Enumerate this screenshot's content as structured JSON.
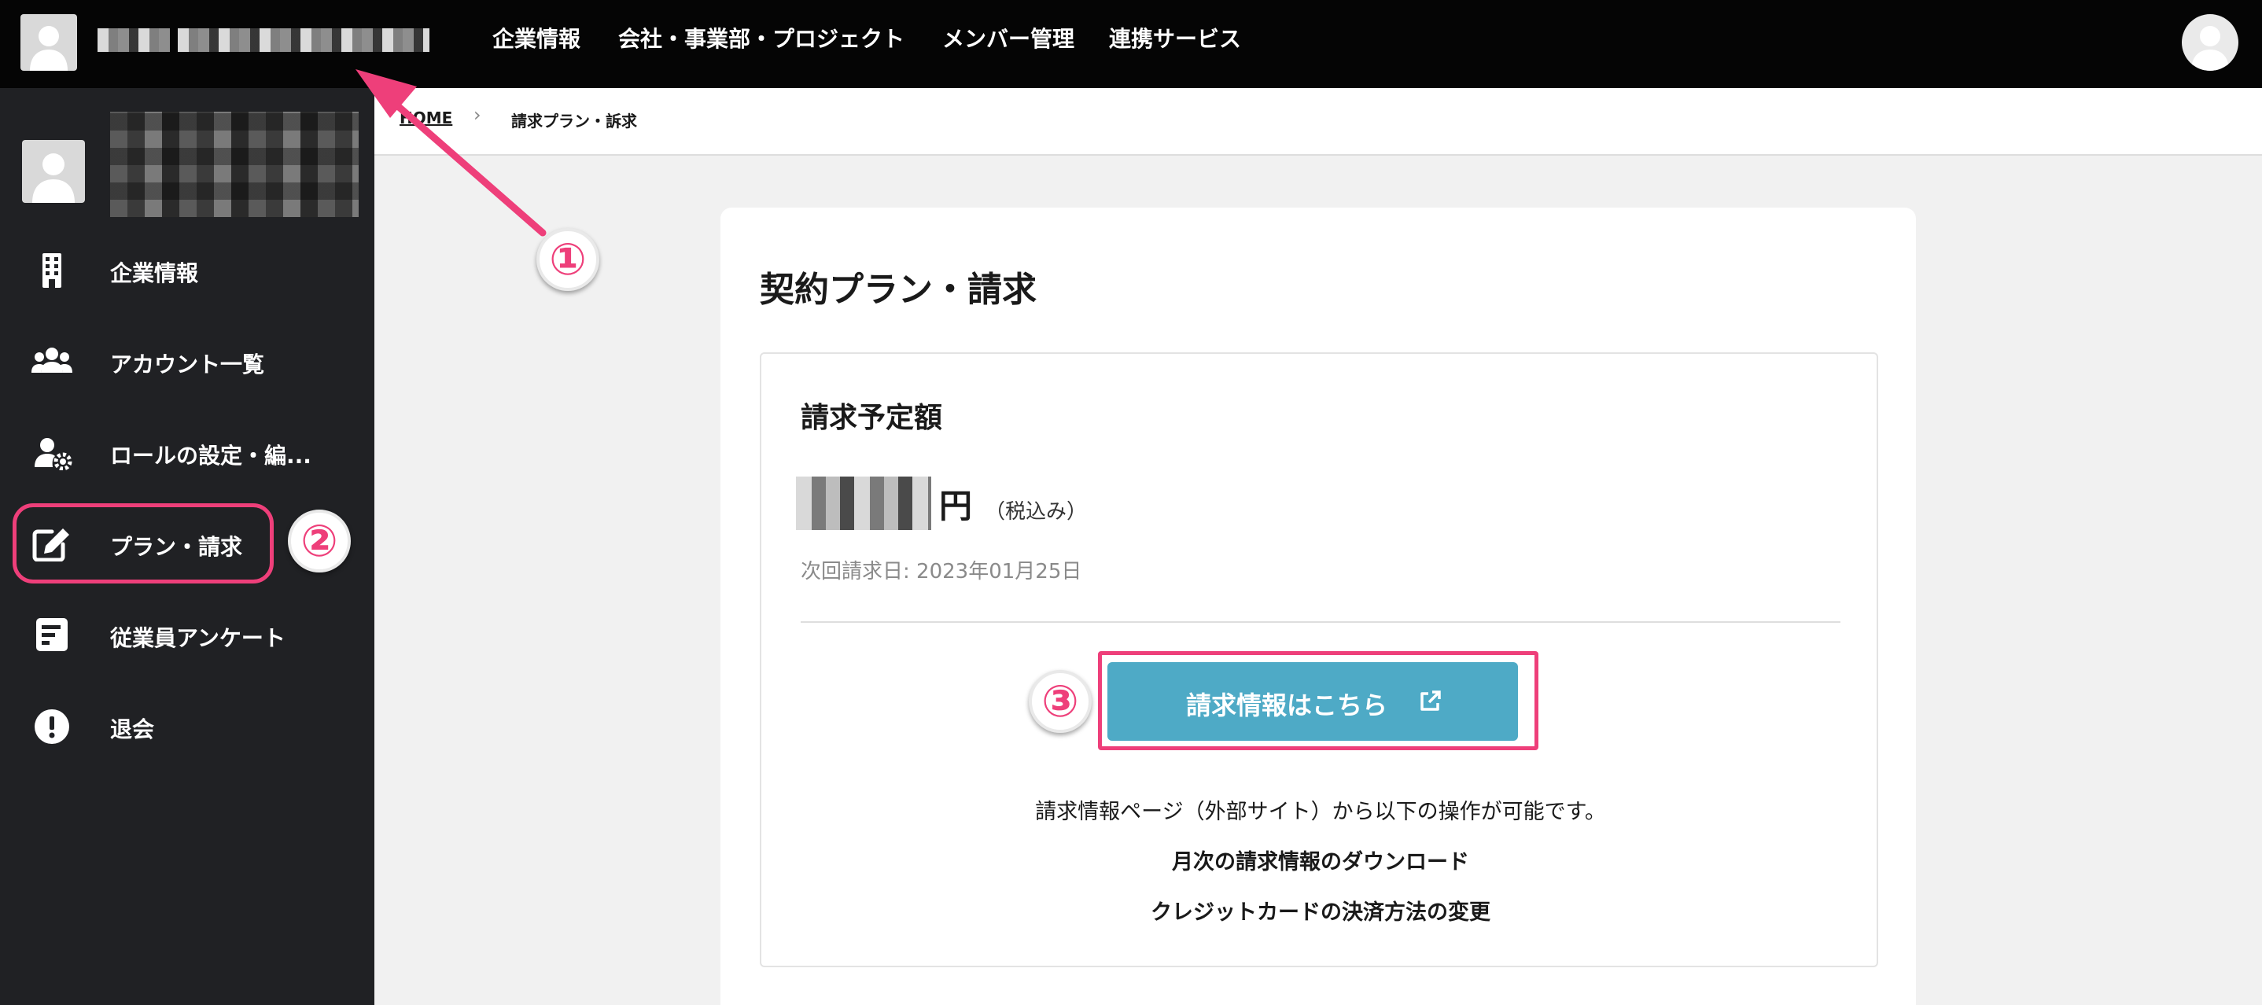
{
  "topbar": {
    "nav": [
      "企業情報",
      "会社・事業部・プロジェクト",
      "メンバー管理",
      "連携サービス"
    ]
  },
  "sidebar": {
    "items": [
      {
        "label": "企業情報",
        "icon": "building-icon"
      },
      {
        "label": "アカウント一覧",
        "icon": "users-icon"
      },
      {
        "label": "ロールの設定・編...",
        "icon": "user-gear-icon"
      },
      {
        "label": "プラン・請求",
        "icon": "edit-icon"
      },
      {
        "label": "従業員アンケート",
        "icon": "survey-icon"
      },
      {
        "label": "退会",
        "icon": "exclamation-icon"
      }
    ]
  },
  "breadcrumb": {
    "home": "HOME",
    "separator": "›",
    "current": "請求プラン・訴求"
  },
  "main": {
    "title": "契約プラン・請求",
    "panel": {
      "title": "請求予定額",
      "currency": "円",
      "tax_note": "（税込み）",
      "next_billing": "次回請求日: 2023年01月25日",
      "button_label": "請求情報はこちら",
      "desc_line1": "請求情報ページ（外部サイト）から以下の操作が可能です。",
      "desc_line2": "月次の請求情報のダウンロード",
      "desc_line3": "クレジットカードの決済方法の変更"
    }
  },
  "annotations": {
    "badge1": "①",
    "badge2": "②",
    "badge3": "③",
    "color": "#ee3f7a"
  },
  "colors": {
    "topbar": "#050505",
    "sidebar": "#202124",
    "button": "#4eaac6",
    "highlight": "#ee3f7a"
  }
}
